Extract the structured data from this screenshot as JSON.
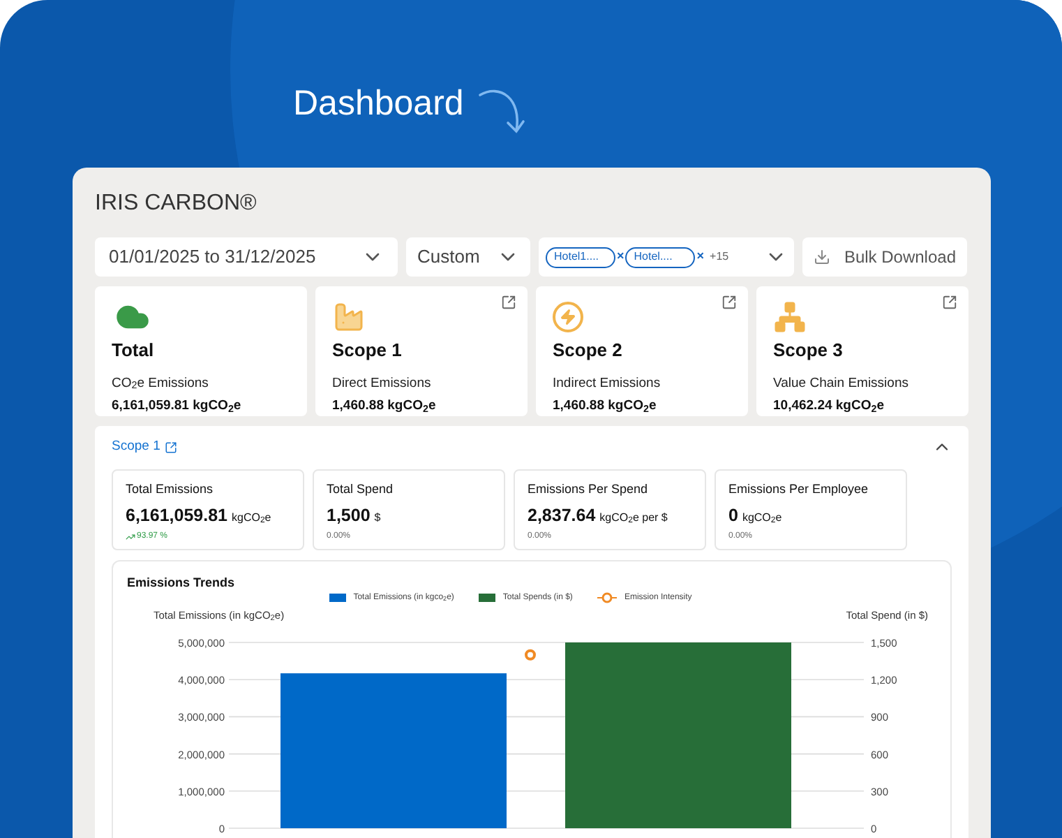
{
  "window": {
    "title": "Dashboard"
  },
  "app": {
    "brand": "IRIS CARBON®"
  },
  "filters": {
    "date_range": "01/01/2025 to 31/12/2025",
    "period": "Custom",
    "hotels": {
      "chips": [
        {
          "label": "Hotel1....",
          "remove": "×"
        },
        {
          "label": "Hotel....",
          "remove": "×"
        }
      ],
      "more": "+15"
    },
    "bulk_download": "Bulk Download"
  },
  "summary_cards": [
    {
      "kind": "total",
      "title": "Total",
      "label": "CO$_{2}$e Emissions",
      "value": "6,161,059.81 kgCO$_{2}$e",
      "link": false
    },
    {
      "kind": "scope1",
      "title": "Scope 1",
      "label": "Direct Emissions",
      "value": "1,460.88 kgCO$_{2}$e",
      "link": true
    },
    {
      "kind": "scope2",
      "title": "Scope 2",
      "label": "Indirect Emissions",
      "value": "1,460.88 kgCO$_{2}$e",
      "link": true
    },
    {
      "kind": "scope3",
      "title": "Scope 3",
      "label": "Value Chain Emissions",
      "value": "10,462.24 kgCO$_{2}$e",
      "link": true
    }
  ],
  "scope_section": {
    "title": "Scope 1",
    "expanded": true,
    "metrics": [
      {
        "label": "Total Emissions",
        "value": "6,161,059.81",
        "unit": "kgCO$_{2}$e",
        "change": "93.97 %",
        "rising": true
      },
      {
        "label": "Total Spend",
        "value": "1,500",
        "unit": "$",
        "change": "0.00%",
        "rising": false
      },
      {
        "label": "Emissions Per Spend",
        "value": "2,837.64",
        "unit": "kgCO$_{2}$e per $",
        "change": "0.00%",
        "rising": false
      },
      {
        "label": "Emissions Per Employee",
        "value": "0",
        "unit": "kgCO$_{2}$e",
        "change": "0.00%",
        "rising": false
      }
    ],
    "chart": {
      "title": "Emissions Trends",
      "chart_data": {
        "type": "bar",
        "grid": true,
        "legend": "top",
        "ylabel": "Total Emissions (in kgCO$_{2}$e)",
        "y2label": "Total Spend (in $)",
        "y2lim": [
          0,
          1500
        ],
        "y2ticks": [
          {
            "value": 1500,
            "label": "1,500"
          },
          {
            "value": 1200,
            "label": "1,200"
          },
          {
            "value": 900,
            "label": "900"
          },
          {
            "value": 600,
            "label": "600"
          },
          {
            "value": 300,
            "label": "300"
          },
          {
            "value": 0,
            "label": "0"
          }
        ],
        "ylim": [
          0,
          5000000
        ],
        "yticks": [
          {
            "value": 5000000,
            "label": "5,000,000"
          },
          {
            "value": 4000000,
            "label": "4,000,000"
          },
          {
            "value": 3000000,
            "label": "3,000,000"
          },
          {
            "value": 2000000,
            "label": "2,000,000"
          },
          {
            "value": 1000000,
            "label": "1,000,000"
          },
          {
            "value": 0,
            "label": "0"
          }
        ],
        "series": [
          {
            "name": "Total Emissions (in kgco$_{2}$e)",
            "color": "#0069c8",
            "type": "bar",
            "values": [
              4170000
            ]
          },
          {
            "name": "Total Spends (in $)",
            "color": "#276e38",
            "type": "bar",
            "axis": "y2",
            "values": [
              1500
            ]
          },
          {
            "name": "Emission Intensity",
            "color": "#f08a24",
            "type": "scatter",
            "axis": "y2",
            "values": [
              1400
            ]
          }
        ]
      }
    }
  }
}
